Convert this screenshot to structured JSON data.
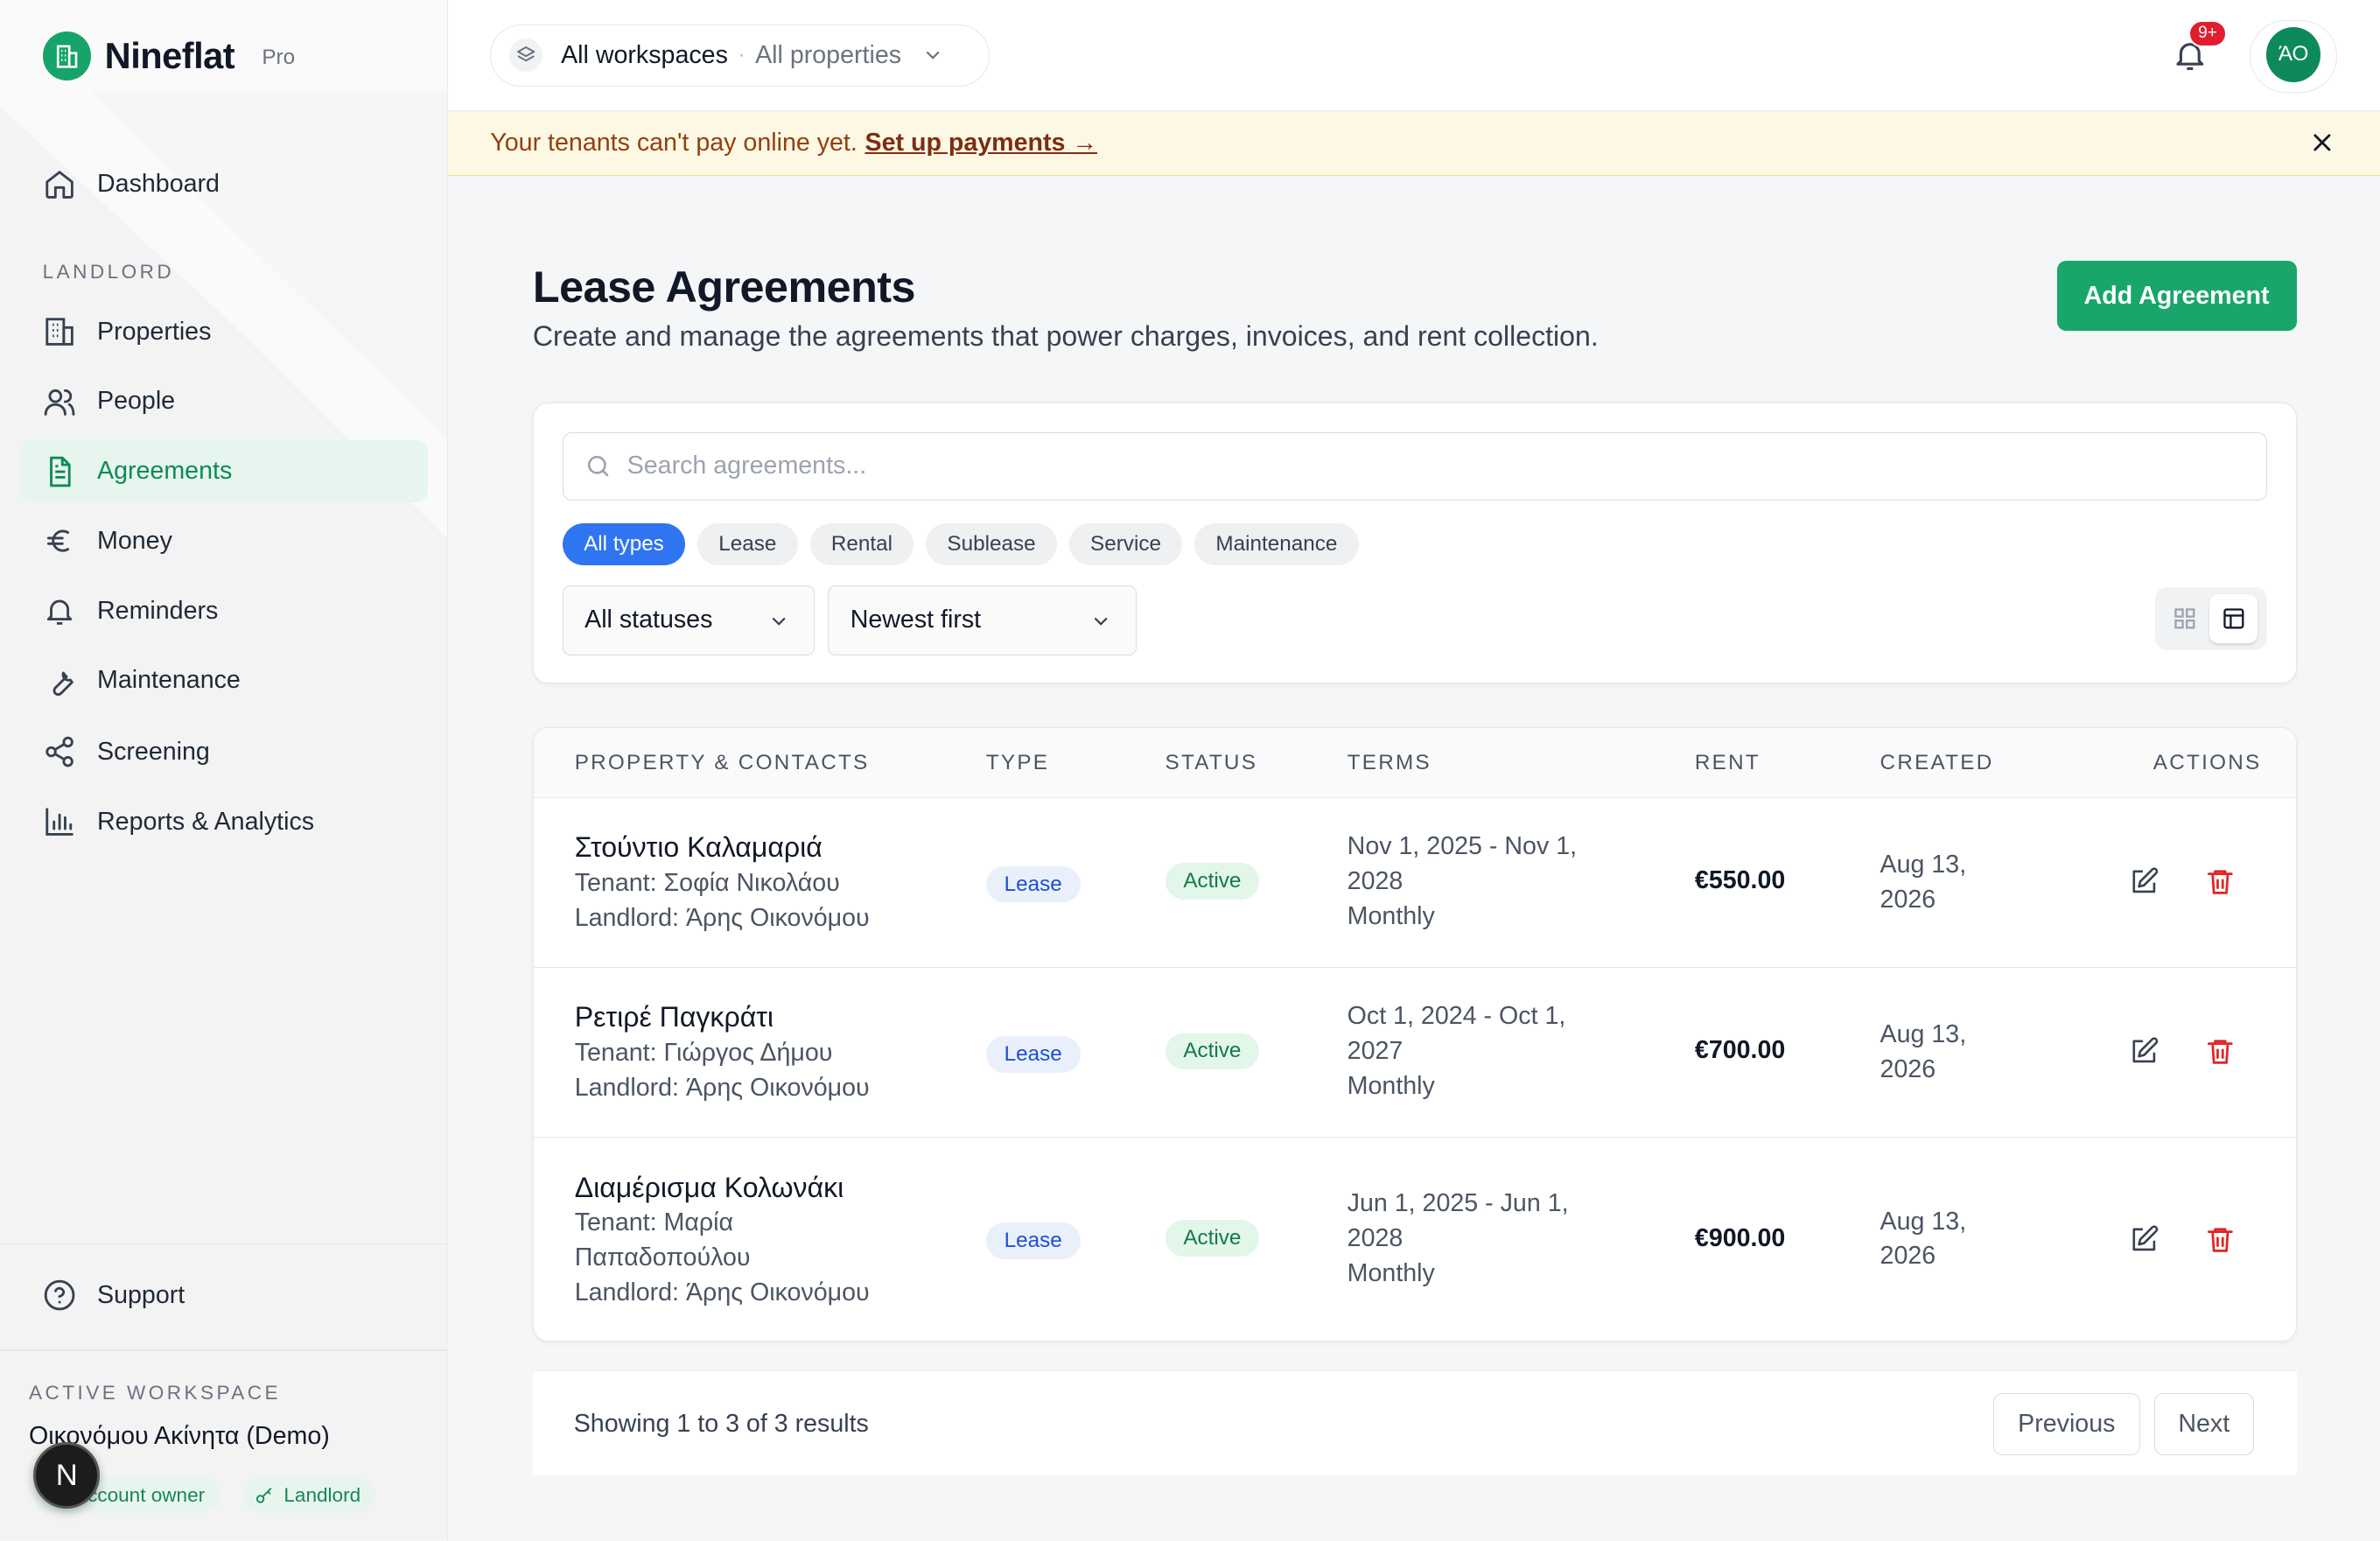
{
  "app": {
    "brand_name": "Nineflat",
    "brand_tier": "Pro",
    "brand_color": "#16a46b"
  },
  "sidebar": {
    "dashboard": {
      "label": "Dashboard",
      "icon": "home-icon"
    },
    "section_label": "LANDLORD",
    "items": [
      {
        "label": "Properties",
        "icon": "building-icon",
        "active": false
      },
      {
        "label": "People",
        "icon": "users-icon",
        "active": false
      },
      {
        "label": "Agreements",
        "icon": "document-icon",
        "active": true
      },
      {
        "label": "Money",
        "icon": "euro-icon",
        "active": false
      },
      {
        "label": "Reminders",
        "icon": "bell-icon",
        "active": false
      },
      {
        "label": "Maintenance",
        "icon": "wrench-icon",
        "active": false
      },
      {
        "label": "Screening",
        "icon": "share-nodes-icon",
        "active": false
      },
      {
        "label": "Reports & Analytics",
        "icon": "bar-chart-icon",
        "active": false
      }
    ],
    "support_label": "Support",
    "workspace": {
      "label": "ACTIVE WORKSPACE",
      "name": "Οικονόμου Ακίνητα (Demo)",
      "badge_owner": "Account owner",
      "badge_role": "Landlord"
    },
    "fab_label": "N"
  },
  "topbar": {
    "workspace_label": "All workspaces",
    "separator": "·",
    "property_label": "All properties",
    "notification_count": "9+",
    "avatar_initials": "ΆΟ"
  },
  "banner": {
    "text": "Your tenants can't pay online yet.",
    "link": "Set up payments →"
  },
  "page": {
    "title": "Lease Agreements",
    "subtitle": "Create and manage the agreements that power charges, invoices, and rent collection.",
    "add_button": "Add Agreement"
  },
  "filters": {
    "search_placeholder": "Search agreements...",
    "types": [
      "All types",
      "Lease",
      "Rental",
      "Sublease",
      "Service",
      "Maintenance"
    ],
    "active_type": "All types",
    "status_select": "All statuses",
    "sort_select": "Newest first",
    "view_mode": "table"
  },
  "table": {
    "columns": [
      "PROPERTY & CONTACTS",
      "TYPE",
      "STATUS",
      "TERMS",
      "RENT",
      "CREATED",
      "ACTIONS"
    ],
    "rows": [
      {
        "property": "Στούντιο Καλαμαριά",
        "tenant_lines": [
          "Tenant: Σοφία Νικολάου"
        ],
        "landlord": "Landlord: Άρης Οικονόμου",
        "type": "Lease",
        "status": "Active",
        "terms_lines": [
          "Nov 1, 2025 - Nov 1,",
          "2028",
          "Monthly"
        ],
        "rent": "€550.00",
        "created_lines": [
          "Aug 13,",
          "2026"
        ]
      },
      {
        "property": "Ρετιρέ Παγκράτι",
        "tenant_lines": [
          "Tenant: Γιώργος Δήμου"
        ],
        "landlord": "Landlord: Άρης Οικονόμου",
        "type": "Lease",
        "status": "Active",
        "terms_lines": [
          "Oct 1, 2024 - Oct 1,",
          "2027",
          "Monthly"
        ],
        "rent": "€700.00",
        "created_lines": [
          "Aug 13,",
          "2026"
        ]
      },
      {
        "property": "Διαμέρισμα Κολωνάκι",
        "tenant_lines": [
          "Tenant: Μαρία",
          "Παπαδοπούλου"
        ],
        "landlord": "Landlord: Άρης Οικονόμου",
        "type": "Lease",
        "status": "Active",
        "terms_lines": [
          "Jun 1, 2025 - Jun 1,",
          "2028",
          "Monthly"
        ],
        "rent": "€900.00",
        "created_lines": [
          "Aug 13,",
          "2026"
        ]
      }
    ]
  },
  "pagination": {
    "summary": "Showing 1 to 3 of 3 results",
    "previous": "Previous",
    "next": "Next"
  },
  "colors": {
    "accent": "#18a66a",
    "active_chip": "#2f74f0",
    "danger": "#e02424",
    "banner_bg": "#fdf8e4"
  }
}
